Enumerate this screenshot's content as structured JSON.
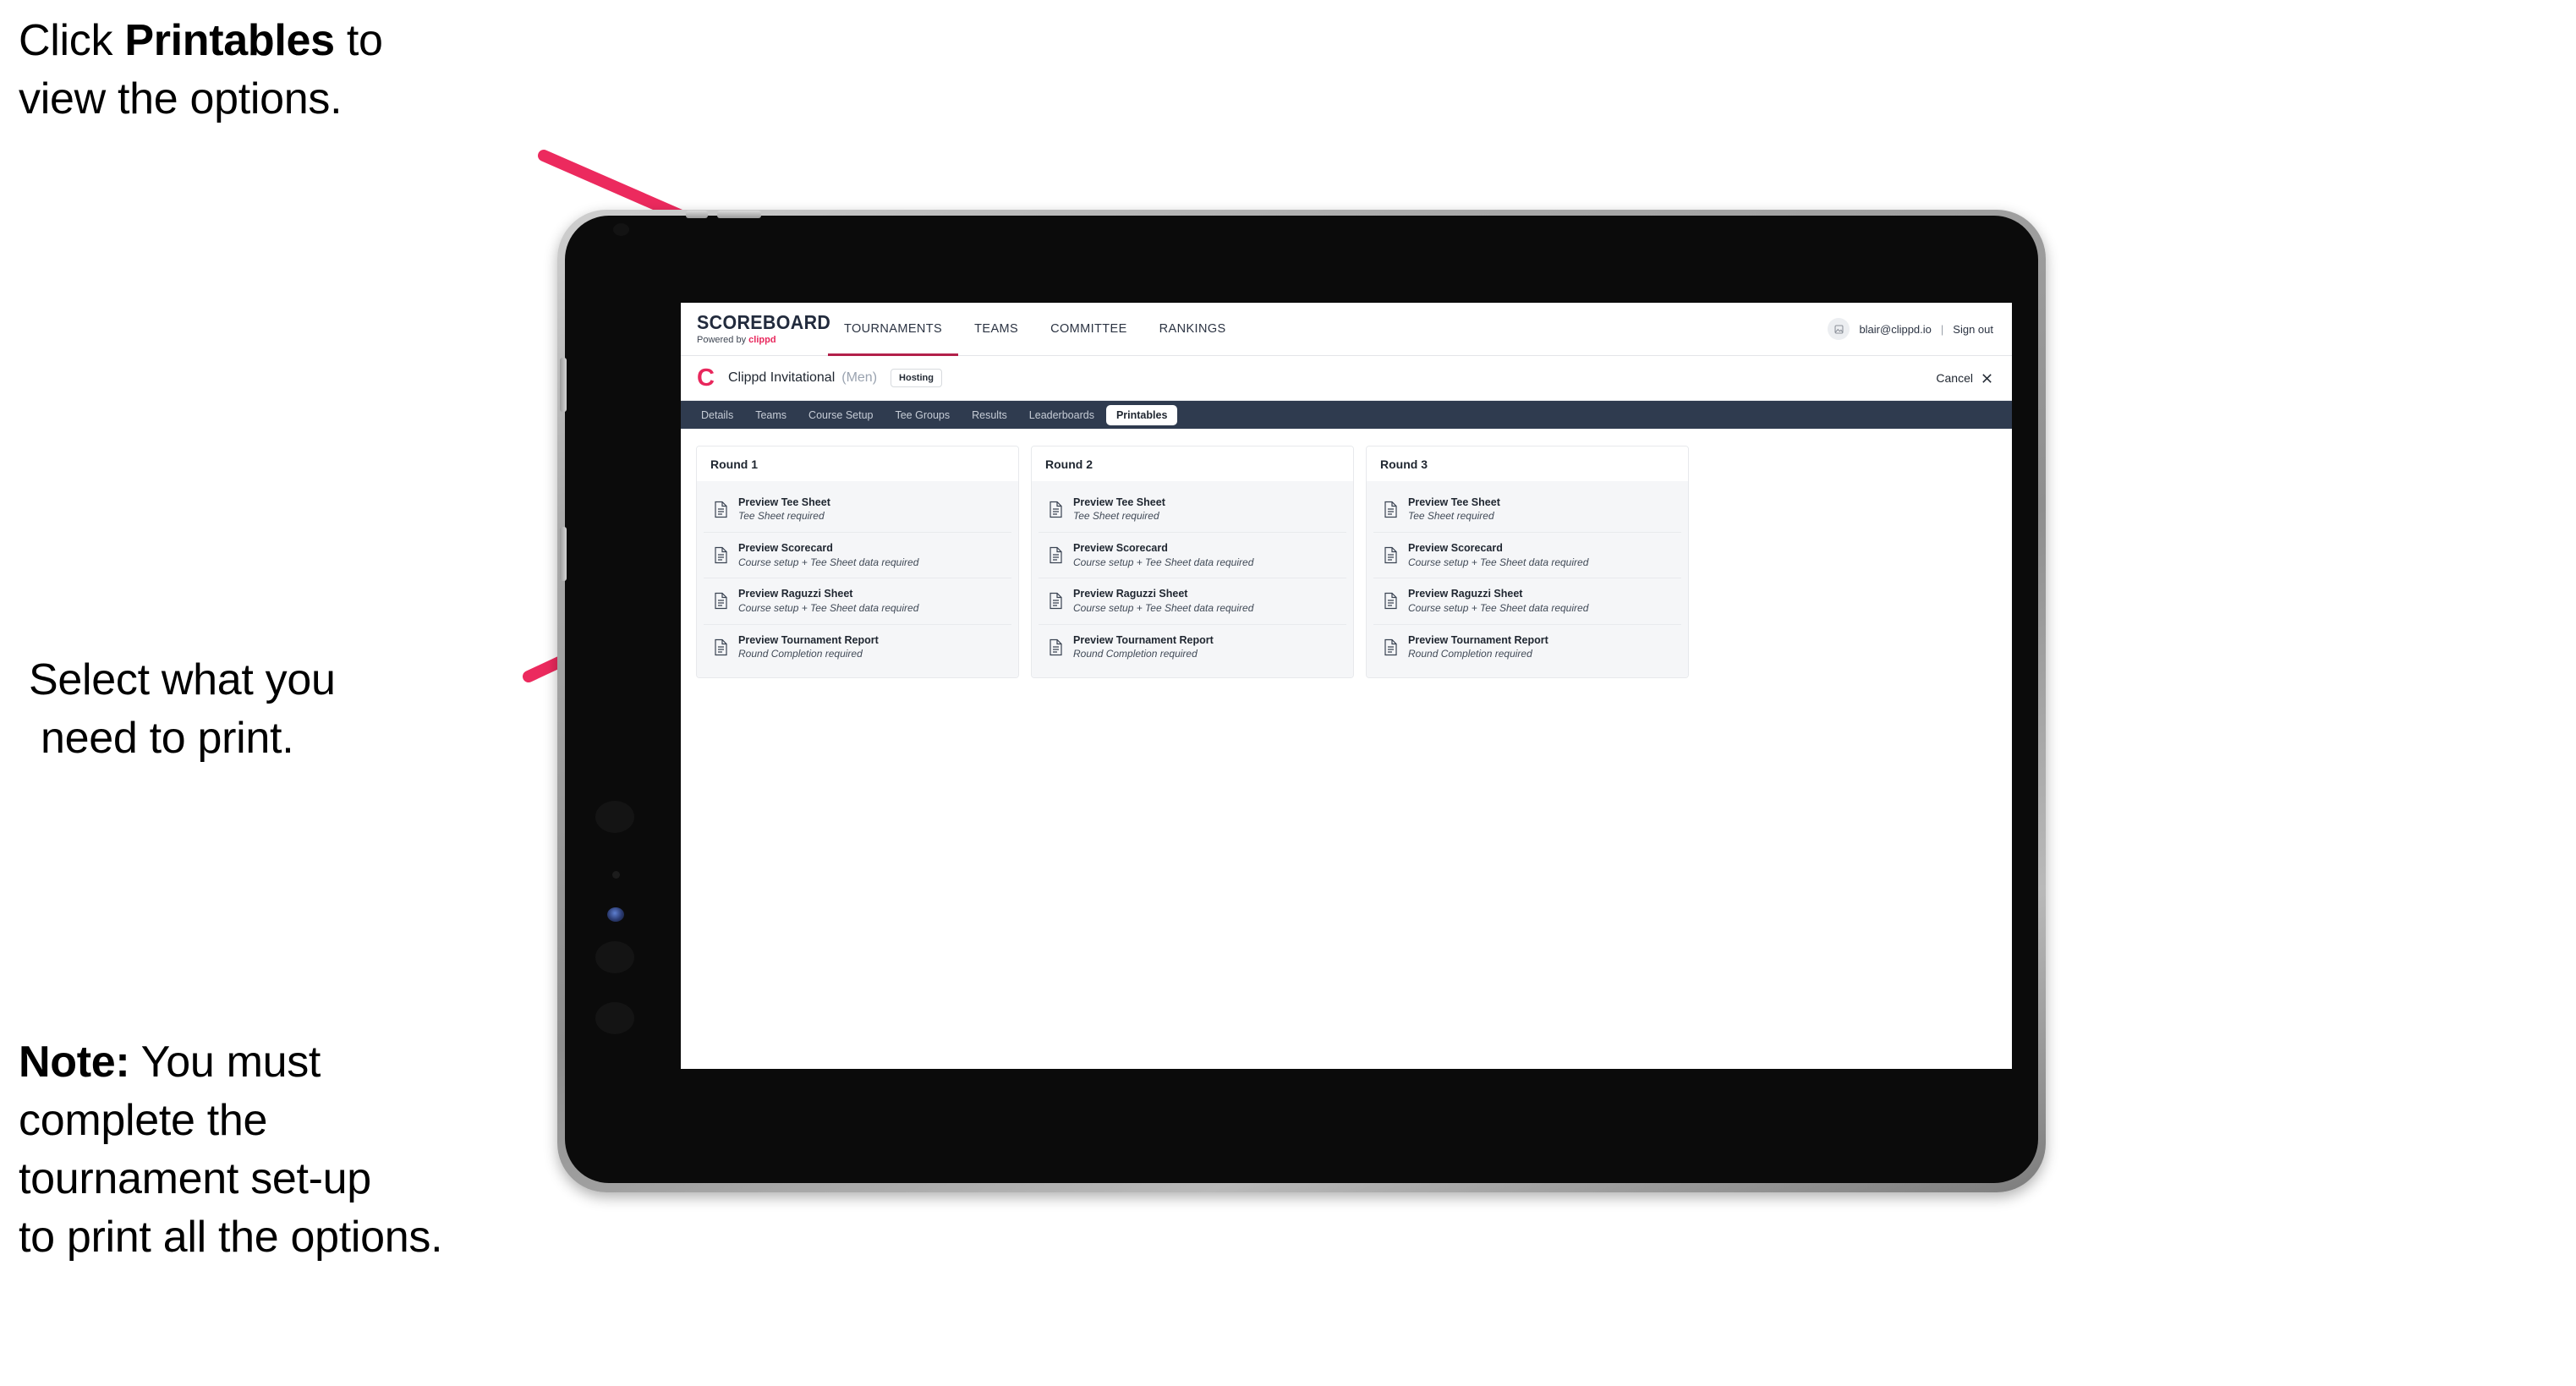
{
  "annotations": {
    "click_printables": {
      "prefix": "Click ",
      "bold": "Printables",
      "suffix": " to\nview the options."
    },
    "select_print_line1": "Select what you",
    "select_print_line2": "need to print.",
    "note": {
      "bold": "Note:",
      "rest": " You must\ncomplete the\ntournament set-up\nto print all the options."
    }
  },
  "colors": {
    "arrow": "#ec2a5e",
    "brand_pink": "#e8275c",
    "subnav_bg": "#2f3b4f",
    "nav_underline": "#b3204a"
  },
  "app": {
    "brand": {
      "wordmark": "SCOREBOARD",
      "powered_by_prefix": "Powered by ",
      "powered_by_brand": "clippd"
    },
    "main_nav": [
      {
        "label": "TOURNAMENTS",
        "active": true
      },
      {
        "label": "TEAMS",
        "active": false
      },
      {
        "label": "COMMITTEE",
        "active": false
      },
      {
        "label": "RANKINGS",
        "active": false
      }
    ],
    "account": {
      "avatar_icon": "user-avatar-icon",
      "email": "blair@clippd.io",
      "separator": "|",
      "sign_out": "Sign out"
    },
    "tournament": {
      "logo_letter": "C",
      "name": "Clippd Invitational",
      "gender": "(Men)",
      "status_badge": "Hosting",
      "cancel_label": "Cancel",
      "cancel_icon": "close-x-icon"
    },
    "sub_nav": [
      {
        "label": "Details",
        "active": false
      },
      {
        "label": "Teams",
        "active": false
      },
      {
        "label": "Course Setup",
        "active": false
      },
      {
        "label": "Tee Groups",
        "active": false
      },
      {
        "label": "Results",
        "active": false
      },
      {
        "label": "Leaderboards",
        "active": false
      },
      {
        "label": "Printables",
        "active": true
      }
    ],
    "printables": {
      "rounds": [
        {
          "title": "Round 1",
          "items": [
            {
              "title": "Preview Tee Sheet",
              "sub": "Tee Sheet required"
            },
            {
              "title": "Preview Scorecard",
              "sub": "Course setup + Tee Sheet data required"
            },
            {
              "title": "Preview Raguzzi Sheet",
              "sub": "Course setup + Tee Sheet data required"
            },
            {
              "title": "Preview Tournament Report",
              "sub": "Round Completion required"
            }
          ]
        },
        {
          "title": "Round 2",
          "items": [
            {
              "title": "Preview Tee Sheet",
              "sub": "Tee Sheet required"
            },
            {
              "title": "Preview Scorecard",
              "sub": "Course setup + Tee Sheet data required"
            },
            {
              "title": "Preview Raguzzi Sheet",
              "sub": "Course setup + Tee Sheet data required"
            },
            {
              "title": "Preview Tournament Report",
              "sub": "Round Completion required"
            }
          ]
        },
        {
          "title": "Round 3",
          "items": [
            {
              "title": "Preview Tee Sheet",
              "sub": "Tee Sheet required"
            },
            {
              "title": "Preview Scorecard",
              "sub": "Course setup + Tee Sheet data required"
            },
            {
              "title": "Preview Raguzzi Sheet",
              "sub": "Course setup + Tee Sheet data required"
            },
            {
              "title": "Preview Tournament Report",
              "sub": "Round Completion required"
            }
          ]
        }
      ]
    }
  }
}
